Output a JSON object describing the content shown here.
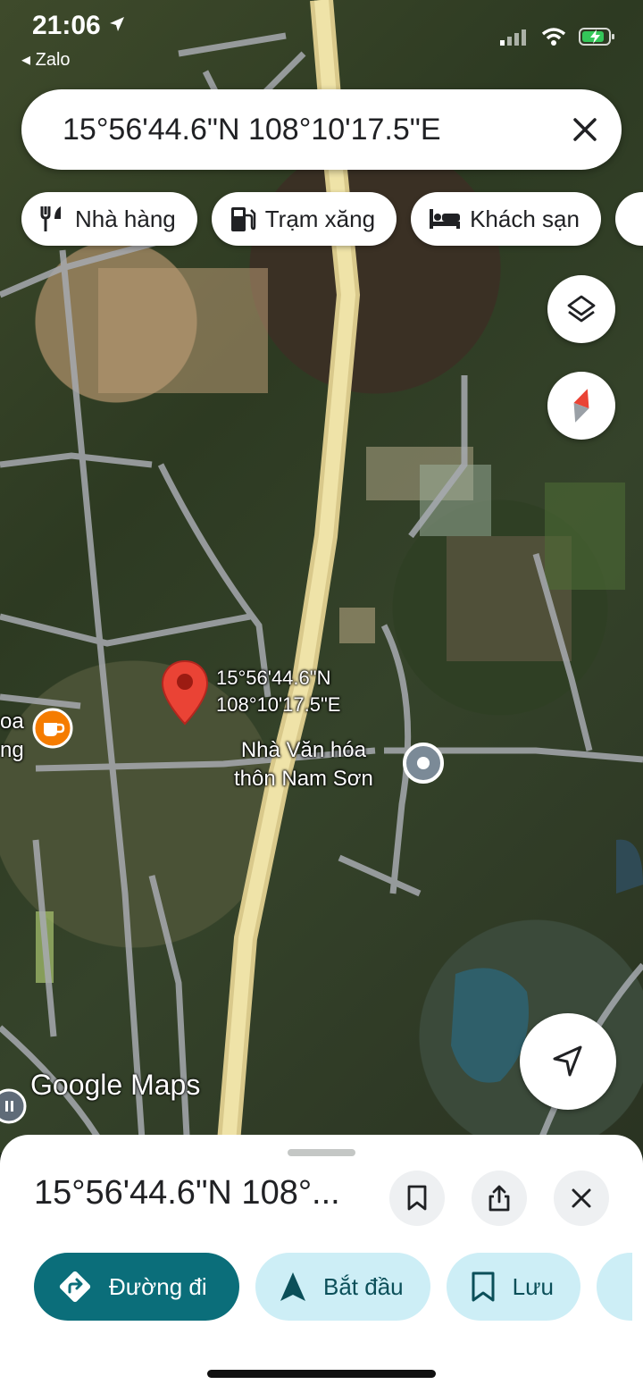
{
  "status_bar": {
    "time": "21:06",
    "back_app": "Zalo",
    "icons": [
      "location-arrow-icon",
      "cellular-signal-icon",
      "wifi-icon",
      "battery-charging-icon"
    ]
  },
  "search": {
    "query": "15°56'44.6\"N 108°10'17.5\"E",
    "clear_icon": "close-icon"
  },
  "chips": [
    {
      "label": "Nhà hàng",
      "icon": "restaurant-icon"
    },
    {
      "label": "Trạm xăng",
      "icon": "gas-station-icon"
    },
    {
      "label": "Khách sạn",
      "icon": "hotel-icon"
    }
  ],
  "map": {
    "marker_label": [
      "15°56'44.6\"N",
      "108°10'17.5\"E"
    ],
    "poi_cafe_label": [
      "oa",
      "ng"
    ],
    "poi_label": [
      "Nhà Văn hóa",
      "thôn Nam Sơn"
    ],
    "logo": "Google Maps",
    "layer_icon": "layers-icon",
    "compass_icon": "compass-icon",
    "locate_icon": "navigation-arrow-icon"
  },
  "sheet": {
    "title": "15°56'44.6\"N 108°...",
    "actions": [
      {
        "label": "Đường đi",
        "icon": "directions-icon"
      },
      {
        "label": "Bắt đầu",
        "icon": "navigation-icon"
      },
      {
        "label": "Lưu",
        "icon": "bookmark-icon"
      }
    ]
  },
  "colors": {
    "primary": "#0b6e7a",
    "secondary": "#cdeef6",
    "marker": "#ea4335",
    "road": "#e8d89a"
  }
}
